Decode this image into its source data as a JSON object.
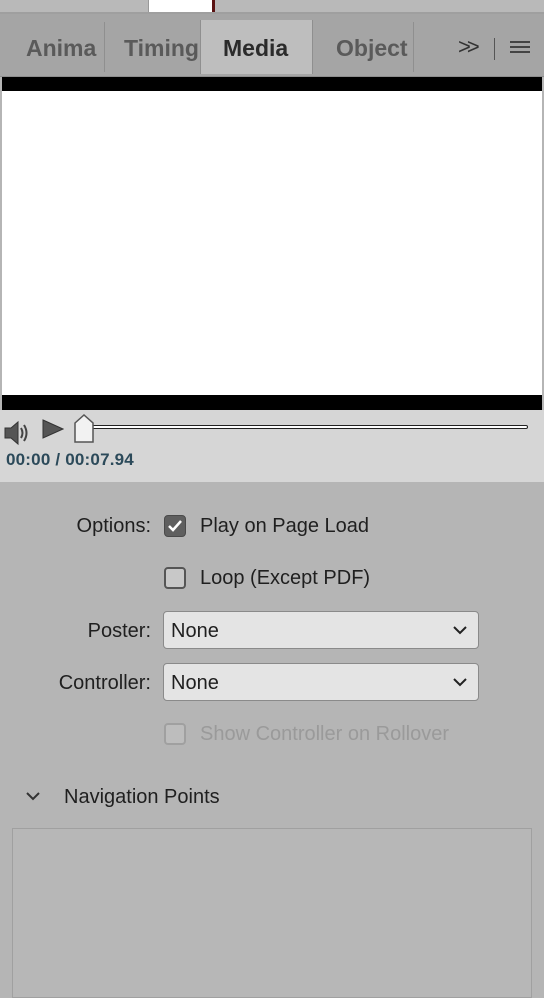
{
  "tabs": [
    {
      "label": "Anima",
      "active": false
    },
    {
      "label": "Timing",
      "active": false
    },
    {
      "label": "Media",
      "active": true
    },
    {
      "label": "Object",
      "active": false
    }
  ],
  "tab_overflow_icon": "double-chevron-right-icon",
  "panel_menu_icon": "hamburger-menu-icon",
  "player": {
    "timecode": "00:00 / 00:07.94",
    "progress": 0
  },
  "options": {
    "label": "Options:",
    "play_on_page_load": {
      "label": "Play on Page Load",
      "checked": true
    },
    "loop": {
      "label": "Loop (Except PDF)",
      "checked": false
    }
  },
  "poster": {
    "label": "Poster:",
    "value": "None"
  },
  "controller": {
    "label": "Controller:",
    "value": "None"
  },
  "show_controller_on_rollover": {
    "label": "Show Controller on Rollover",
    "checked": false,
    "disabled": true
  },
  "navigation_points": {
    "title": "Navigation Points",
    "expanded": true
  }
}
